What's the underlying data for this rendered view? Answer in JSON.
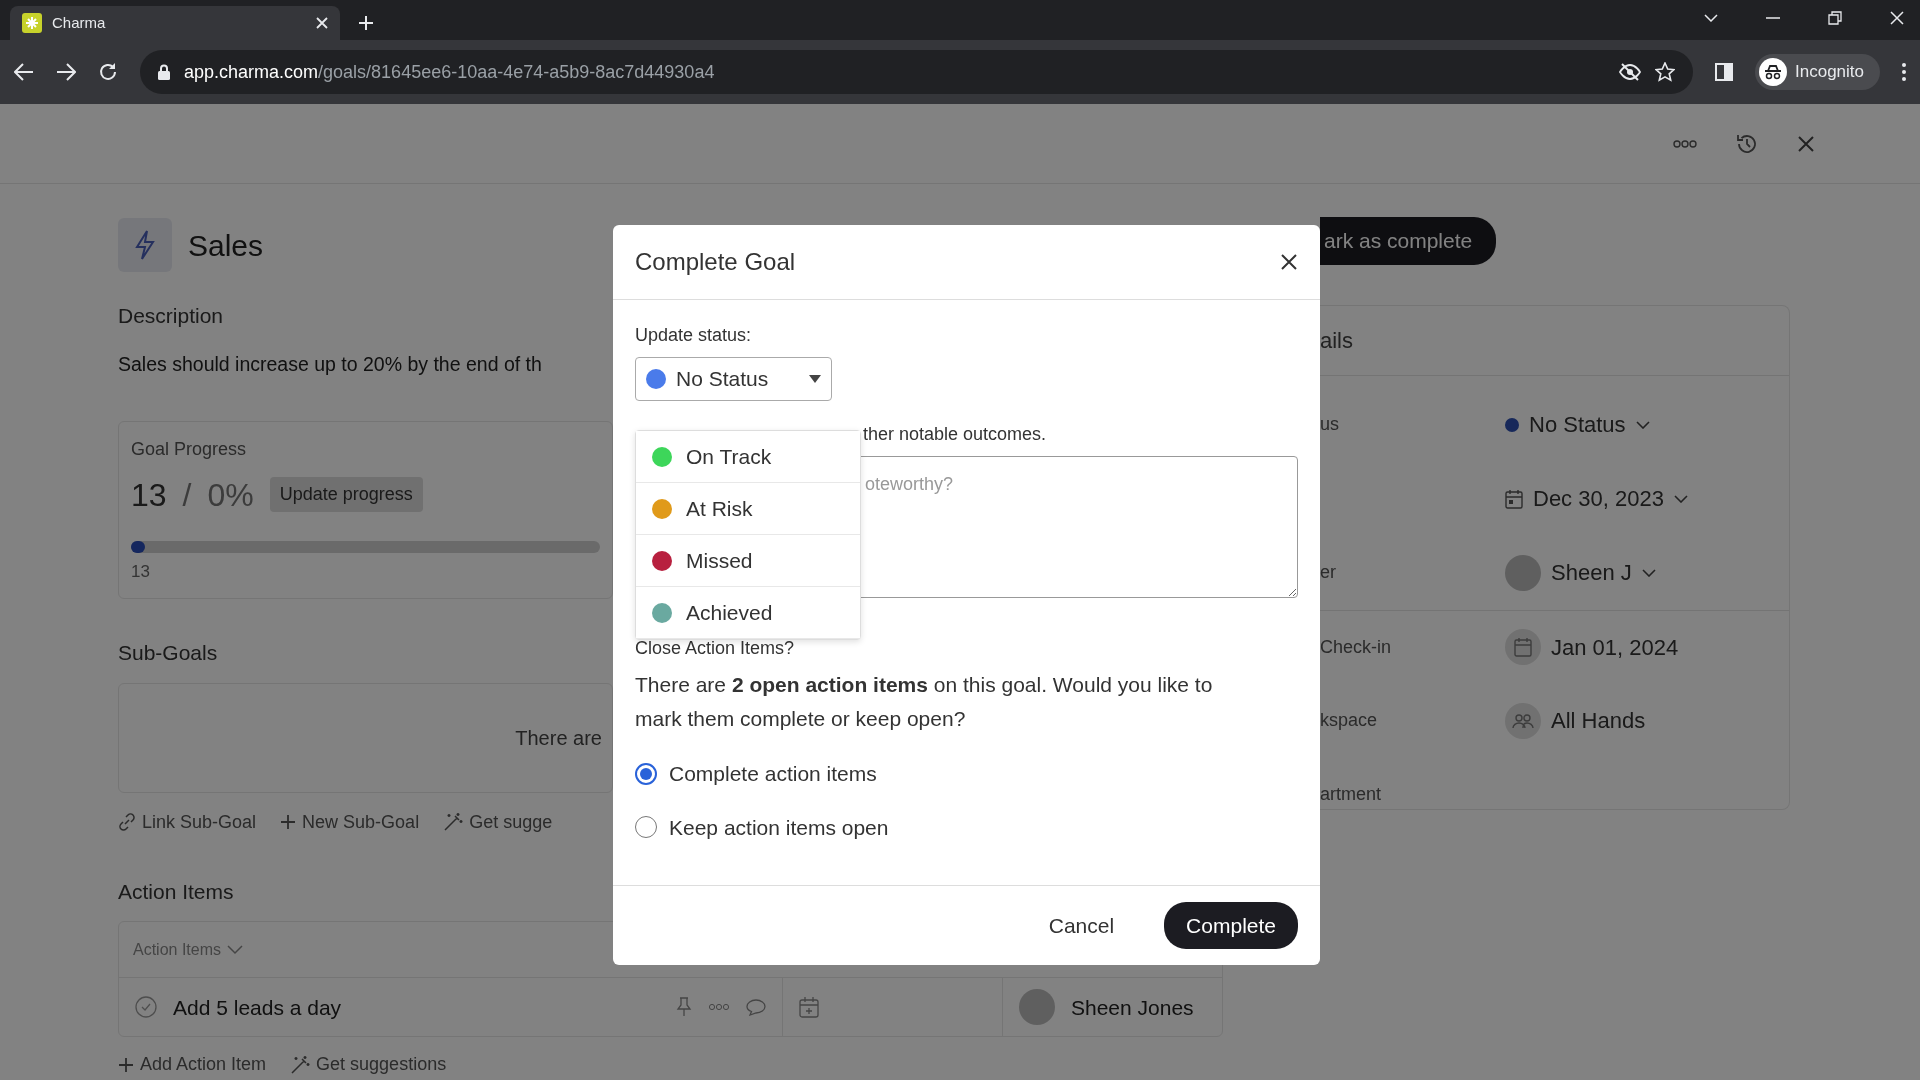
{
  "browser": {
    "tab_title": "Charma",
    "url_host": "app.charma.com",
    "url_path": "/goals/81645ee6-10aa-4e74-a5b9-8ac7d44930a4",
    "profile": "Incognito"
  },
  "goal": {
    "title": "Sales",
    "description_label": "Description",
    "description": "Sales should increase up to 20% by the end of th",
    "progress": {
      "title": "Goal Progress",
      "current": "13",
      "separator": "/",
      "percent": "0%",
      "button": "Update progress",
      "level": 0.03,
      "value_label": "13"
    },
    "subgoals": {
      "title": "Sub-Goals",
      "empty_text": "There are",
      "actions": [
        {
          "label": "Link Sub-Goal",
          "kind": "link"
        },
        {
          "label": "New Sub-Goal",
          "kind": "plus"
        },
        {
          "label": "Get sugge",
          "kind": "wand"
        }
      ]
    },
    "action_items": {
      "title": "Action Items",
      "header": "Action Items",
      "rows": [
        {
          "title": "Add 5 leads a day",
          "done": false,
          "assignee": "Sheen Jones"
        }
      ],
      "actions": [
        {
          "label": "Add Action Item",
          "kind": "plus"
        },
        {
          "label": "Get suggestions",
          "kind": "wand"
        }
      ]
    }
  },
  "mark_complete_button": "ark as complete",
  "details": {
    "title": "ails",
    "fields": [
      {
        "label": "us",
        "value": "No Status",
        "kind": "status"
      },
      {
        "value": "Dec 30, 2023",
        "kind": "date"
      },
      {
        "label": "er",
        "value": "Sheen J",
        "kind": "person"
      },
      {
        "label": "Check-in",
        "value": "Jan 01, 2024",
        "kind": "checkin"
      },
      {
        "label": "kspace",
        "value": "All Hands",
        "kind": "workspace"
      },
      {
        "label": "artment",
        "kind": "plain"
      }
    ]
  },
  "modal": {
    "title": "Complete Goal",
    "status_label": "Update status:",
    "status_select": {
      "value": "No Status",
      "color": "#4a7bea"
    },
    "status_options": [
      {
        "label": "On Track",
        "color": "#3dd65a"
      },
      {
        "label": "At Risk",
        "color": "#e09a1a"
      },
      {
        "label": "Missed",
        "color": "#b8203f"
      },
      {
        "label": "Achieved",
        "color": "#6aa9a0"
      }
    ],
    "outcomes_label": "ther notable outcomes.",
    "outcomes_placeholder": "oteworthy?",
    "close_items_label": "Close Action Items?",
    "close_items_text": "There are **2 open action items** on this goal. Would you like to mark them complete or keep open?",
    "radios": [
      {
        "label": "Complete action items",
        "selected": true
      },
      {
        "label": "Keep action items open",
        "selected": false
      }
    ],
    "cancel": "Cancel",
    "submit": "Complete"
  }
}
